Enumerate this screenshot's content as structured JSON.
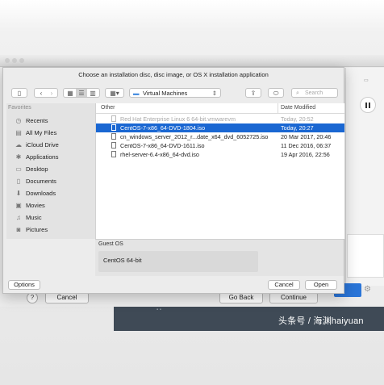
{
  "dialog": {
    "title": "Choose an installation disc, disc image, or OS X installation application",
    "location": "Virtual Machines",
    "search_placeholder": "Search"
  },
  "sidebar": {
    "heading": "Favorites",
    "items": [
      {
        "label": "Recents",
        "icon": "clock-icon"
      },
      {
        "label": "All My Files",
        "icon": "files-icon"
      },
      {
        "label": "iCloud Drive",
        "icon": "cloud-icon"
      },
      {
        "label": "Applications",
        "icon": "applications-icon"
      },
      {
        "label": "Desktop",
        "icon": "desktop-icon"
      },
      {
        "label": "Documents",
        "icon": "document-icon"
      },
      {
        "label": "Downloads",
        "icon": "download-icon"
      },
      {
        "label": "Movies",
        "icon": "film-icon"
      },
      {
        "label": "Music",
        "icon": "music-icon"
      },
      {
        "label": "Pictures",
        "icon": "camera-icon"
      }
    ]
  },
  "filelist": {
    "col_name": "Other",
    "col_date": "Date Modified",
    "rows": [
      {
        "name": "Red Hat Enterprise Linux 6 64-bit.vmwarevm",
        "date": "Today, 20:52"
      },
      {
        "name": "CentOS-7-x86_64-DVD-1804.iso",
        "date": "Today, 20:27"
      },
      {
        "name": "cn_windows_server_2012_r...date_x64_dvd_6052725.iso",
        "date": "20 Mar 2017, 20:46"
      },
      {
        "name": "CentOS-7-x86_64-DVD-1611.iso",
        "date": "11 Dec 2016, 06:37"
      },
      {
        "name": "rhel-server-6.4-x86_64-dvd.iso",
        "date": "19 Apr 2016, 22:56"
      }
    ]
  },
  "guest": {
    "label": "Guest OS",
    "value": "CentOS 64-bit"
  },
  "buttons": {
    "options": "Options",
    "cancel": "Cancel",
    "open": "Open"
  },
  "background": {
    "help": "?",
    "cancel": "Cancel",
    "go_back": "Go Back",
    "continue": "Continue",
    "watermark": "头条号 / 海渊haiyuan"
  },
  "colors": {
    "selection": "#1a67d2",
    "accent_button": "#2a75d8"
  }
}
